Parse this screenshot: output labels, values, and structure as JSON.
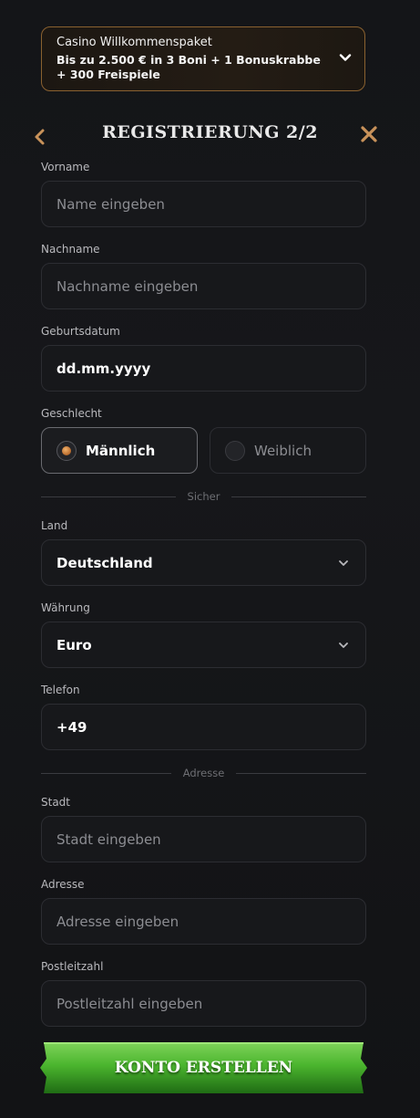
{
  "promo": {
    "title": "Casino Willkommenspaket",
    "text": "Bis zu 2.500 € in 3 Boni + 1 Bonuskrabbe + 300 Freispiele"
  },
  "header": {
    "title": "REGISTRIERUNG 2/2"
  },
  "fields": {
    "vorname": {
      "label": "Vorname",
      "placeholder": "Name eingeben"
    },
    "nachname": {
      "label": "Nachname",
      "placeholder": "Nachname eingeben"
    },
    "geburtsdatum": {
      "label": "Geburtsdatum",
      "value": "dd.mm.yyyy"
    },
    "geschlecht": {
      "label": "Geschlecht",
      "options": [
        "Männlich",
        "Weiblich"
      ],
      "selected": "Männlich"
    },
    "land": {
      "label": "Land",
      "value": "Deutschland"
    },
    "waehrung": {
      "label": "Währung",
      "value": "Euro"
    },
    "telefon": {
      "label": "Telefon",
      "value": "+49"
    },
    "stadt": {
      "label": "Stadt",
      "placeholder": "Stadt eingeben"
    },
    "adresse": {
      "label": "Adresse",
      "placeholder": "Adresse eingeben"
    },
    "postleitzahl": {
      "label": "Postleitzahl",
      "placeholder": "Postleitzahl eingeben"
    }
  },
  "dividers": {
    "sicher": "Sicher",
    "adresse": "Adresse"
  },
  "cta": {
    "label": "KONTO ERSTELLEN"
  },
  "colors": {
    "accent": "#c8925a",
    "cta_green": "#4bb52e",
    "promo_border": "#8a6130"
  },
  "icons": {
    "back": "chevron-left-icon",
    "close": "close-icon",
    "dropdown": "chevron-down-icon"
  }
}
